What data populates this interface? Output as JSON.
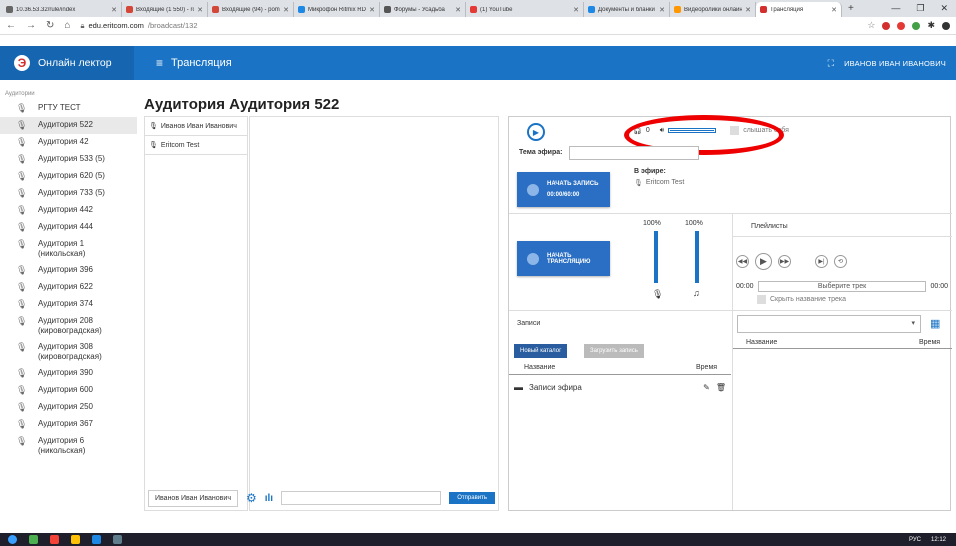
{
  "browser": {
    "tabs": [
      {
        "title": "10.36.53.32/rule/index",
        "color": "#666",
        "width": 120
      },
      {
        "title": "Входящие (1 550) - roc",
        "color": "#d44638",
        "width": 86
      },
      {
        "title": "Входящие (94) - pomel",
        "color": "#d44638",
        "width": 86
      },
      {
        "title": "Микрофон Ritmix RDM",
        "color": "#1e88e5",
        "width": 86
      },
      {
        "title": "Форумы - Усадьба",
        "color": "#555",
        "width": 86
      },
      {
        "title": "(1) YouTube",
        "color": "#e53935",
        "width": 118
      },
      {
        "title": "Документы и бланки",
        "color": "#1e88e5",
        "width": 86
      },
      {
        "title": "Видеоролики онлайн",
        "color": "#ff9800",
        "width": 86
      },
      {
        "title": "Трансляция",
        "color": "#d32f2f",
        "width": 86,
        "active": true
      }
    ],
    "window_min": "—",
    "window_max": "❐",
    "window_close": "✕",
    "url_domain": "edu.eritcom.com",
    "url_path": "/broadcast/132"
  },
  "app": {
    "brand": "Онлайн лектор",
    "title": "Трансляция",
    "user": "ИВАНОВ ИВАН ИВАНОВИЧ",
    "accent": "#1a73c4"
  },
  "sidebar": {
    "group": "Аудитории",
    "items": [
      {
        "label": "РГТУ ТЕСТ"
      },
      {
        "label": "Аудитория 522",
        "active": true
      },
      {
        "label": "Аудитория 42"
      },
      {
        "label": "Аудитория 533 (5)"
      },
      {
        "label": "Аудитория 620 (5)"
      },
      {
        "label": "Аудитория 733 (5)"
      },
      {
        "label": "Аудитория 442"
      },
      {
        "label": "Аудитория 444"
      },
      {
        "label": "Аудитория 1 (никольская)"
      },
      {
        "label": "Аудитория 396"
      },
      {
        "label": "Аудитория 622"
      },
      {
        "label": "Аудитория 374"
      },
      {
        "label": "Аудитория 208 (кировоградская)"
      },
      {
        "label": "Аудитория 308 (кировоградская)"
      },
      {
        "label": "Аудитория 390"
      },
      {
        "label": "Аудитория 600"
      },
      {
        "label": "Аудитория 250"
      },
      {
        "label": "Аудитория 367"
      },
      {
        "label": "Аудитория 6 (никольская)"
      }
    ]
  },
  "main": {
    "title": "Аудитория Аудитория 522",
    "users": [
      "Иванов Иван Иванович",
      "Eritcom Test"
    ],
    "chat_user": "Иванов Иван Иванович",
    "send_label": "Отправить"
  },
  "broadcast": {
    "headphones_count": "0",
    "listen_self_label": "слышать себя",
    "topic_label": "Тема эфира:",
    "topic_value": "",
    "on_air_label": "В эфире:",
    "on_air_user": "Eritcom Test",
    "record_label": "НАЧАТЬ ЗАПИСЬ",
    "record_time": "00:00/60:00",
    "broadcast_label": "НАЧАТЬ ТРАНСЛЯЦИЮ",
    "mic_level": "100%",
    "music_level": "100%"
  },
  "records": {
    "tab_label": "Записи",
    "new_catalog": "Новый каталог",
    "upload": "Загрузить запись",
    "col_name": "Название",
    "col_time": "Время",
    "items": [
      {
        "name": "Записи эфира"
      }
    ]
  },
  "playlist": {
    "tab_label": "Плейлисты",
    "time_start": "00:00",
    "track_placeholder": "Выберите трек",
    "time_end": "00:00",
    "hide_track_label": "Скрыть название трека",
    "col_name": "Название",
    "col_time": "Время"
  },
  "taskbar": {
    "lang": "РУС",
    "clock": "12:12"
  }
}
